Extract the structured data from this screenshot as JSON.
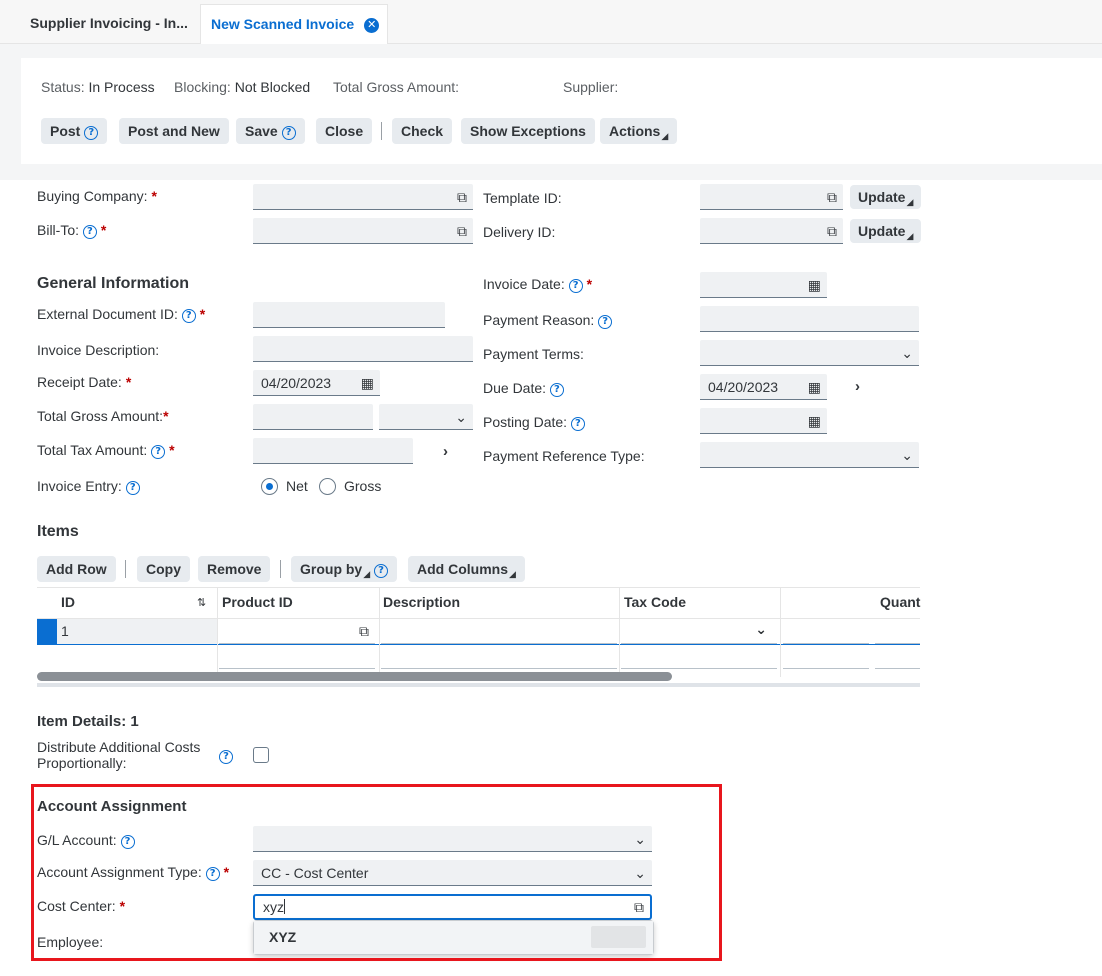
{
  "tabs": [
    {
      "label": "Supplier Invoicing - In..."
    },
    {
      "label": "New Scanned Invoice"
    }
  ],
  "status": {
    "status_label": "Status:",
    "status_value": "In Process",
    "blocking_label": "Blocking:",
    "blocking_value": "Not Blocked",
    "gross_label": "Total Gross Amount:",
    "supplier_label": "Supplier:"
  },
  "toolbar": {
    "post": "Post",
    "post_and_new": "Post and New",
    "save": "Save",
    "close": "Close",
    "check": "Check",
    "show_exceptions": "Show Exceptions",
    "actions": "Actions"
  },
  "form": {
    "buying_company": "Buying Company:",
    "bill_to": "Bill-To:",
    "template_id": "Template ID:",
    "delivery_id": "Delivery ID:",
    "update": "Update",
    "general_information": "General Information",
    "external_document_id": "External Document ID:",
    "invoice_description": "Invoice Description:",
    "receipt_date": "Receipt Date:",
    "receipt_date_value": "04/20/2023",
    "total_gross_amount": "Total Gross Amount:",
    "total_tax_amount": "Total Tax Amount:",
    "invoice_entry": "Invoice Entry:",
    "net": "Net",
    "gross": "Gross",
    "invoice_date": "Invoice Date:",
    "payment_reason": "Payment Reason:",
    "payment_terms": "Payment Terms:",
    "due_date": "Due Date:",
    "due_date_value": "04/20/2023",
    "posting_date": "Posting Date:",
    "payment_reference_type": "Payment Reference Type:"
  },
  "items": {
    "title": "Items",
    "toolbar": {
      "add_row": "Add Row",
      "copy": "Copy",
      "remove": "Remove",
      "group_by": "Group by",
      "add_columns": "Add Columns"
    },
    "columns": [
      "ID",
      "Product ID",
      "Description",
      "Tax Code",
      "Quant"
    ],
    "rows": [
      {
        "id": "1"
      }
    ]
  },
  "item_details": {
    "title": "Item Details: 1",
    "distribute_line1": "Distribute Additional Costs",
    "distribute_line2": "Proportionally:"
  },
  "account_assignment": {
    "title": "Account Assignment",
    "gl_account": "G/L Account:",
    "type_label": "Account Assignment Type:",
    "type_value": "CC - Cost Center",
    "cost_center": "Cost Center:",
    "cost_center_value": "xyz",
    "employee": "Employee:",
    "suggestion": "XYZ"
  },
  "colors": {
    "accent": "#0a6ed1",
    "required": "#bb0000",
    "highlight": "#e8161d"
  }
}
